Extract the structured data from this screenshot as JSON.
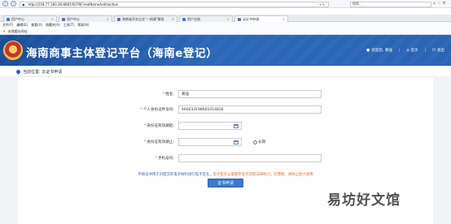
{
  "browser": {
    "back_icon": "back-arrow-icon",
    "forward_icon": "forward-arrow-icon",
    "url": "http://218.77.183.36:8087/SCPSF/realNameAuth/action",
    "search_placeholder": "搜索...",
    "tabs": [
      {
        "label": "用户中心",
        "color": "#3c78c8"
      },
      {
        "label": "用户中心",
        "color": "#3c78c8"
      },
      {
        "label": "海南省开办企业\"一网通\"服务",
        "color": "#3c78c8"
      },
      {
        "label": "用户注册",
        "color": "#3c78c8"
      },
      {
        "label": "云证书申请",
        "color": "#3c78c8"
      }
    ],
    "menu": [
      "文件(F)",
      "编辑(E)",
      "查看(V)",
      "收藏夹(A)",
      "工具(T)",
      "帮助(H)"
    ],
    "favorites_label": "本地缓存网站"
  },
  "header": {
    "title": "海南商事主体登记平台（海南e登记）",
    "welcome": "欢迎您, 黄强",
    "home": "首页",
    "logout": "退出",
    "colors": {
      "banner": "#2a64b4",
      "accent": "#3a79cc"
    }
  },
  "breadcrumb": "当前位置: 云证书申请",
  "form": {
    "name": {
      "label": "姓名:",
      "value": "黄强",
      "required": true
    },
    "id_number": {
      "label": "个人身份证件号码:",
      "value": "460033198601014816",
      "required": true
    },
    "id_start": {
      "label": "身份证有效期起:",
      "value": "",
      "required": true
    },
    "id_end": {
      "label": "身份证有效期止:",
      "value": "",
      "required": true
    },
    "long_term_label": "长期",
    "phone": {
      "label": "手机号码:",
      "value": "",
      "required": true
    },
    "notice_blue": "申请证书用于对提交的电子材料进行电子签名，",
    "notice_orange": "电子签名与掌握手签名同等法律效力，有需性，并防止他人冒用",
    "submit_label": "证书申请"
  },
  "watermark": "易坊好文馆"
}
